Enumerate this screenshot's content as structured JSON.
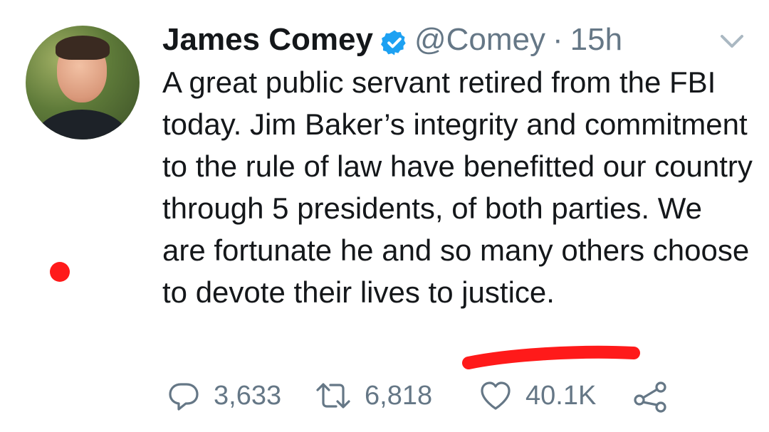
{
  "tweet": {
    "author_name": "James Comey",
    "handle": "@Comey",
    "separator": "·",
    "time": "15h",
    "text": "A great public servant retired from the FBI today. Jim Baker’s integrity and commitment to the rule of law have benefitted our country through 5 presidents, of both parties. We are fortunate he and so many others choose to devote their lives to justice."
  },
  "actions": {
    "replies": "3,633",
    "retweets": "6,818",
    "likes": "40.1K"
  },
  "colors": {
    "verified": "#1da1f2",
    "muted": "#657786",
    "annotation": "#ff1a1a"
  },
  "icons": [
    "verified-badge-icon",
    "chevron-down-icon",
    "reply-icon",
    "retweet-icon",
    "like-icon",
    "share-icon"
  ]
}
